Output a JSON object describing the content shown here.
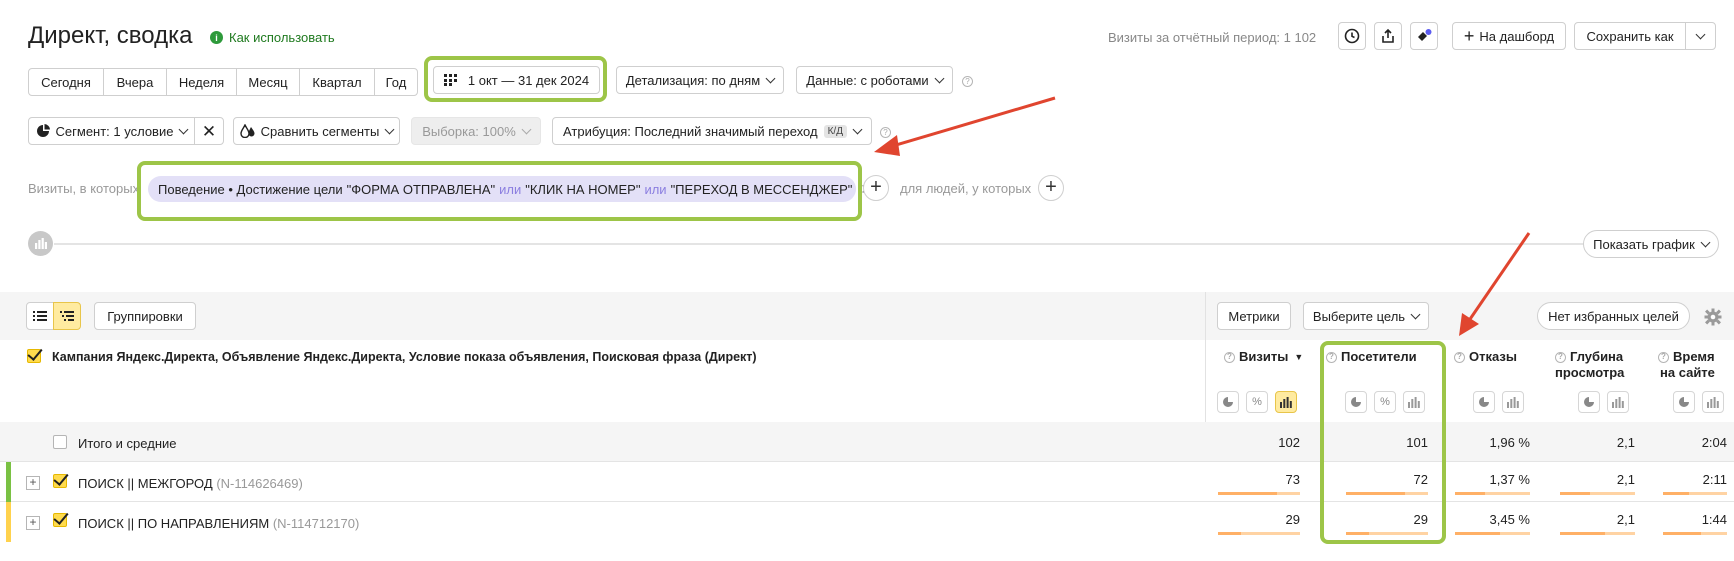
{
  "header": {
    "title": "Директ, сводка",
    "how_to_use": "Как использовать",
    "visits_period": "Визиты за отчётный период: 1 102",
    "to_dashboard": "На дашборд",
    "save_as": "Сохранить как"
  },
  "period": {
    "presets": [
      "Сегодня",
      "Вчера",
      "Неделя",
      "Месяц",
      "Квартал",
      "Год"
    ],
    "range": "1 окт — 31 дек 2024",
    "detail": "Детализация: по дням",
    "data": "Данные: с роботами"
  },
  "filters": {
    "segment": "Сегмент: 1 условие",
    "compare": "Сравнить сегменты",
    "sample": "Выборка: 100%",
    "attribution": "Атрибуция: Последний значимый переход",
    "attribution_badge": "К/Д",
    "visits_where": "Визиты, в которых",
    "condition_prefix": "Поведение • Достижение цели",
    "goal1": "\"ФОРМА ОТПРАВЛЕНА\"",
    "or1": "или",
    "goal2": "\"КЛИК НА НОМЕР\"",
    "or2": "или",
    "goal3": "\"ПЕРЕХОД В МЕССЕНДЖЕР\"",
    "people_where": "для людей, у которых"
  },
  "chart_toggle": {
    "show_chart": "Показать график"
  },
  "table_toolbar": {
    "groupings": "Группировки",
    "metrics": "Метрики",
    "choose_goal": "Выберите цель",
    "no_fav_goals": "Нет избранных целей"
  },
  "table": {
    "dimensions_header": "Кампания Яндекс.Директа, Объявление Яндекс.Директа, Условие показа объявления, Поисковая фраза (Директ)",
    "columns": [
      {
        "label": "Визиты",
        "sorted": "▼"
      },
      {
        "label": "Посетители"
      },
      {
        "label": "Отказы"
      },
      {
        "label_line1": "Глубина",
        "label_line2": "просмотра"
      },
      {
        "label_line1": "Время",
        "label_line2": "на сайте"
      }
    ],
    "totals": {
      "label": "Итого и средние",
      "visits": "102",
      "visitors": "101",
      "bounce": "1,96 %",
      "depth": "2,1",
      "time": "2:04"
    },
    "rows": [
      {
        "name": "ПОИСК || МЕЖГОРОД",
        "id": "(N-114626469)",
        "visits": "73",
        "visitors": "72",
        "bounce": "1,37 %",
        "depth": "2,1",
        "time": "2:11",
        "share": 0.72,
        "color": "#7ac143"
      },
      {
        "name": "ПОИСК || ПО НАПРАВЛЕНИЯМ",
        "id": "(N-114712170)",
        "visits": "29",
        "visitors": "29",
        "bounce": "3,45 %",
        "depth": "2,1",
        "time": "1:44",
        "share": 0.28,
        "color": "#ffd24d"
      }
    ]
  },
  "colors": {
    "highlight_frame": "#9dc548",
    "annotation_arrow": "#e0452f",
    "bar_fill": "#ffb066",
    "bar_track": "#ffd3a3",
    "chip_bg": "#e3e0f7"
  }
}
